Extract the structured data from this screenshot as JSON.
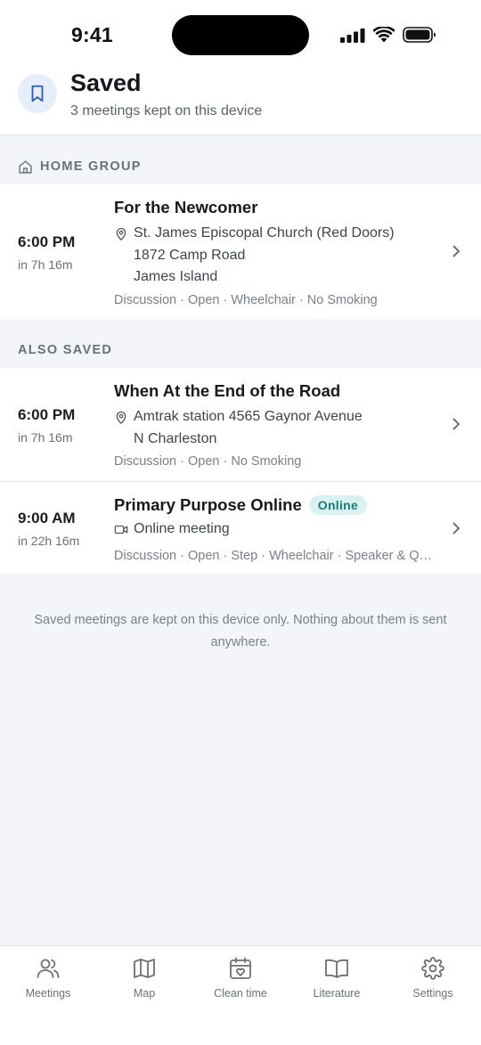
{
  "status_bar": {
    "time": "9:41"
  },
  "header": {
    "title": "Saved",
    "subtitle": "3 meetings kept on this device",
    "icon": "bookmark-icon"
  },
  "sections": {
    "home_group": {
      "label": "HOME GROUP",
      "icon": "home-icon"
    },
    "also_saved": {
      "label": "ALSO SAVED"
    }
  },
  "meetings": [
    {
      "time": "6:00 PM",
      "relative": "in 7h 16m",
      "title": "For the Newcomer",
      "location_line1": "St. James Episcopal Church (Red Doors)",
      "location_line2": "1872 Camp Road",
      "location_line3": "James Island",
      "tags": "Discussion · Open · Wheelchair · No Smoking",
      "icon": "location-pin-icon"
    },
    {
      "time": "6:00 PM",
      "relative": "in 7h 16m",
      "title": "When At the End of the Road",
      "location_line1": "Amtrak station 4565 Gaynor Avenue",
      "location_line2": "N Charleston",
      "tags": "Discussion · Open · No Smoking",
      "icon": "location-pin-icon"
    },
    {
      "time": "9:00 AM",
      "relative": "in 22h 16m",
      "title": "Primary Purpose Online",
      "badge": "Online",
      "location_line1": "Online meeting",
      "tags": "Discussion · Open · Step · Wheelchair · Speaker & Question",
      "icon": "video-icon"
    }
  ],
  "footer_note": "Saved meetings are kept on this device only. Nothing about them is sent anywhere.",
  "tabs": [
    {
      "label": "Meetings",
      "icon": "people-icon"
    },
    {
      "label": "Map",
      "icon": "map-icon"
    },
    {
      "label": "Clean time",
      "icon": "calendar-heart-icon"
    },
    {
      "label": "Literature",
      "icon": "book-icon"
    },
    {
      "label": "Settings",
      "icon": "gear-icon"
    }
  ],
  "colors": {
    "accent": "#2f5fb3",
    "badge_bg": "#d9f2f1",
    "badge_text": "#1b7d79",
    "background": "#f3f5f8"
  }
}
